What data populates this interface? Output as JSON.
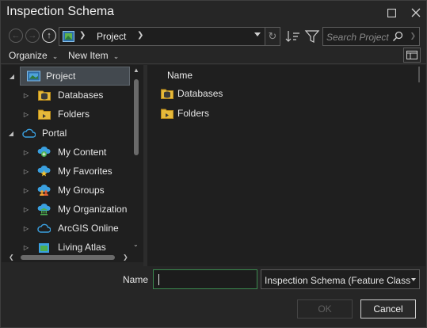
{
  "window": {
    "title": "Inspection Schema",
    "maximize_icon": "maximize-icon",
    "close_icon": "close-icon"
  },
  "navigation": {
    "back_icon": "arrow-left-circle-icon",
    "forward_icon": "arrow-right-circle-icon",
    "up_icon": "arrow-up-circle-icon",
    "location": "Project",
    "refresh_icon": "refresh-icon",
    "sort_icon": "sort-icon",
    "filter_icon": "filter-icon",
    "search_placeholder": "Search Project",
    "search_icon": "search-icon"
  },
  "toolbar": {
    "organize_label": "Organize",
    "new_item_label": "New Item",
    "view_icon": "details-pane-icon"
  },
  "tree": {
    "items": [
      {
        "label": "Project",
        "icon": "project-icon",
        "expanded": true,
        "selected": true
      },
      {
        "label": "Databases",
        "icon": "database-folder-icon"
      },
      {
        "label": "Folders",
        "icon": "folder-icon"
      },
      {
        "label": "Portal",
        "icon": "cloud-icon",
        "expanded": true
      },
      {
        "label": "My Content",
        "icon": "my-content-icon"
      },
      {
        "label": "My Favorites",
        "icon": "favorites-icon"
      },
      {
        "label": "My Groups",
        "icon": "groups-icon"
      },
      {
        "label": "My Organization",
        "icon": "organization-icon"
      },
      {
        "label": "ArcGIS Online",
        "icon": "cloud-icon"
      },
      {
        "label": "Living Atlas",
        "icon": "living-atlas-icon"
      }
    ]
  },
  "list": {
    "column_header": "Name",
    "rows": [
      {
        "label": "Databases",
        "icon": "database-folder-icon"
      },
      {
        "label": "Folders",
        "icon": "folder-icon"
      }
    ]
  },
  "footer": {
    "name_label": "Name",
    "name_value": "",
    "type_value": "Inspection Schema (Feature Classes)",
    "ok_label": "OK",
    "cancel_label": "Cancel"
  },
  "colors": {
    "background": "#1f1f1f",
    "selection": "#43494f",
    "input_focus_border": "#3b8a4f",
    "folder_yellow": "#e6b93a",
    "portal_blue": "#3aa0e0"
  }
}
